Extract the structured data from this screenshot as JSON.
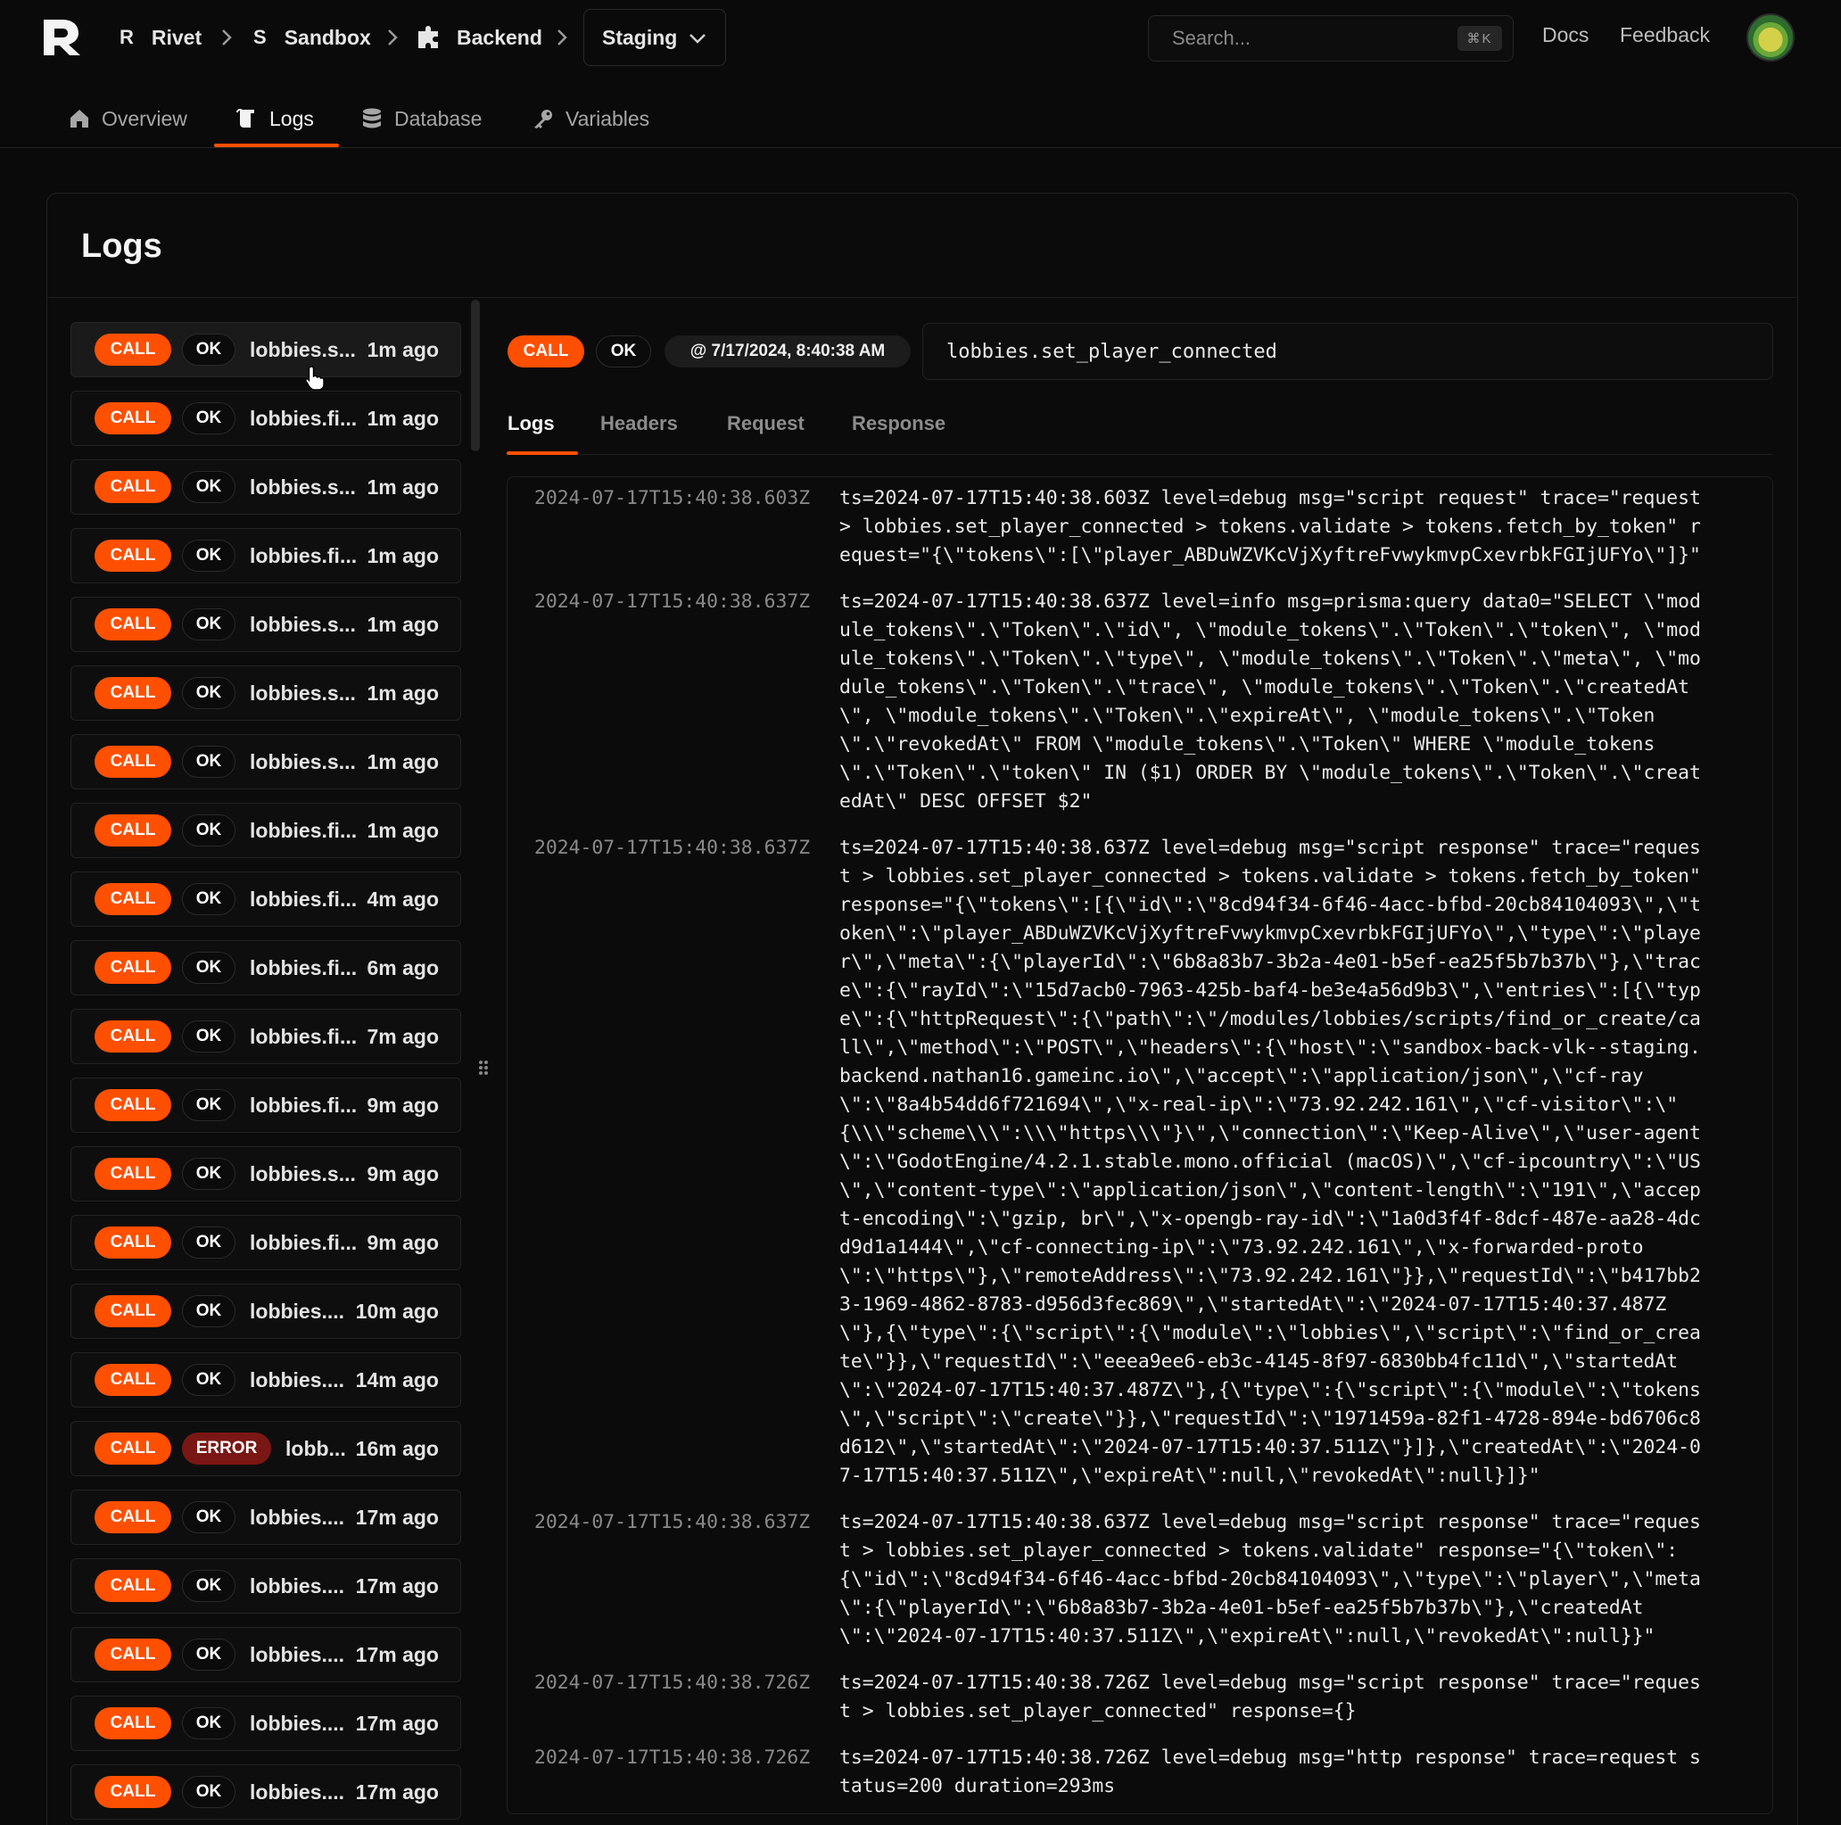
{
  "breadcrumb": {
    "org_initial": "R",
    "org": "Rivet",
    "project_initial": "S",
    "project": "Sandbox",
    "backend": "Backend",
    "environment": "Staging"
  },
  "search": {
    "placeholder": "Search...",
    "shortcut": "⌘K"
  },
  "top_links": {
    "docs": "Docs",
    "feedback": "Feedback"
  },
  "nav_tabs": [
    {
      "label": "Overview",
      "icon": "home-icon"
    },
    {
      "label": "Logs",
      "icon": "logs-icon"
    },
    {
      "label": "Database",
      "icon": "database-icon"
    },
    {
      "label": "Variables",
      "icon": "key-icon"
    }
  ],
  "active_nav_tab": "Logs",
  "page": {
    "title": "Logs"
  },
  "colors": {
    "accent": "#ff4f00",
    "error": "#7a1714",
    "background": "#0a0a0a"
  },
  "log_list": [
    {
      "type": "CALL",
      "status": "OK",
      "name": "lobbies.s...",
      "time": "1m ago"
    },
    {
      "type": "CALL",
      "status": "OK",
      "name": "lobbies.fi...",
      "time": "1m ago"
    },
    {
      "type": "CALL",
      "status": "OK",
      "name": "lobbies.s...",
      "time": "1m ago"
    },
    {
      "type": "CALL",
      "status": "OK",
      "name": "lobbies.fi...",
      "time": "1m ago"
    },
    {
      "type": "CALL",
      "status": "OK",
      "name": "lobbies.s...",
      "time": "1m ago"
    },
    {
      "type": "CALL",
      "status": "OK",
      "name": "lobbies.s...",
      "time": "1m ago"
    },
    {
      "type": "CALL",
      "status": "OK",
      "name": "lobbies.s...",
      "time": "1m ago"
    },
    {
      "type": "CALL",
      "status": "OK",
      "name": "lobbies.fi...",
      "time": "1m ago"
    },
    {
      "type": "CALL",
      "status": "OK",
      "name": "lobbies.fi...",
      "time": "4m ago"
    },
    {
      "type": "CALL",
      "status": "OK",
      "name": "lobbies.fi...",
      "time": "6m ago"
    },
    {
      "type": "CALL",
      "status": "OK",
      "name": "lobbies.fi...",
      "time": "7m ago"
    },
    {
      "type": "CALL",
      "status": "OK",
      "name": "lobbies.fi...",
      "time": "9m ago"
    },
    {
      "type": "CALL",
      "status": "OK",
      "name": "lobbies.s...",
      "time": "9m ago"
    },
    {
      "type": "CALL",
      "status": "OK",
      "name": "lobbies.fi...",
      "time": "9m ago"
    },
    {
      "type": "CALL",
      "status": "OK",
      "name": "lobbies....",
      "time": "10m ago"
    },
    {
      "type": "CALL",
      "status": "OK",
      "name": "lobbies....",
      "time": "14m ago"
    },
    {
      "type": "CALL",
      "status": "ERROR",
      "name": "lobb...",
      "time": "16m ago"
    },
    {
      "type": "CALL",
      "status": "OK",
      "name": "lobbies....",
      "time": "17m ago"
    },
    {
      "type": "CALL",
      "status": "OK",
      "name": "lobbies....",
      "time": "17m ago"
    },
    {
      "type": "CALL",
      "status": "OK",
      "name": "lobbies....",
      "time": "17m ago"
    },
    {
      "type": "CALL",
      "status": "OK",
      "name": "lobbies....",
      "time": "17m ago"
    },
    {
      "type": "CALL",
      "status": "OK",
      "name": "lobbies....",
      "time": "17m ago"
    }
  ],
  "selected_index": 0,
  "detail": {
    "type": "CALL",
    "status": "OK",
    "timestamp": "@ 7/17/2024, 8:40:38 AM",
    "function": "lobbies.set_player_connected",
    "tabs": [
      "Logs",
      "Headers",
      "Request",
      "Response"
    ],
    "active_tab": "Logs",
    "entries": [
      {
        "ts": "2024-07-17T15:40:38.603Z",
        "lines": [
          "ts=2024-07-17T15:40:38.603Z level=debug msg=\"script request\" trace=\"request",
          "> lobbies.set_player_connected > tokens.validate > tokens.fetch_by_token\" r",
          "equest=\"{\\\"tokens\\\":[\\\"player_ABDuWZVKcVjXyftreFvwykmvpCxevrbkFGIjUFYo\\\"]}\""
        ]
      },
      {
        "ts": "2024-07-17T15:40:38.637Z",
        "lines": [
          "ts=2024-07-17T15:40:38.637Z level=info msg=prisma:query data0=\"SELECT \\\"mod",
          "ule_tokens\\\".\\\"Token\\\".\\\"id\\\", \\\"module_tokens\\\".\\\"Token\\\".\\\"token\\\", \\\"mod",
          "ule_tokens\\\".\\\"Token\\\".\\\"type\\\", \\\"module_tokens\\\".\\\"Token\\\".\\\"meta\\\", \\\"mo",
          "dule_tokens\\\".\\\"Token\\\".\\\"trace\\\", \\\"module_tokens\\\".\\\"Token\\\".\\\"createdAt",
          "\\\", \\\"module_tokens\\\".\\\"Token\\\".\\\"expireAt\\\", \\\"module_tokens\\\".\\\"Token",
          "\\\".\\\"revokedAt\\\" FROM \\\"module_tokens\\\".\\\"Token\\\" WHERE \\\"module_tokens",
          "\\\".\\\"Token\\\".\\\"token\\\" IN ($1) ORDER BY \\\"module_tokens\\\".\\\"Token\\\".\\\"creat",
          "edAt\\\" DESC OFFSET $2\""
        ]
      },
      {
        "ts": "2024-07-17T15:40:38.637Z",
        "lines": [
          "ts=2024-07-17T15:40:38.637Z level=debug msg=\"script response\" trace=\"reques",
          "t > lobbies.set_player_connected > tokens.validate > tokens.fetch_by_token\"",
          "response=\"{\\\"tokens\\\":[{\\\"id\\\":\\\"8cd94f34-6f46-4acc-bfbd-20cb84104093\\\",\\\"t",
          "oken\\\":\\\"player_ABDuWZVKcVjXyftreFvwykmvpCxevrbkFGIjUFYo\\\",\\\"type\\\":\\\"playe",
          "r\\\",\\\"meta\\\":{\\\"playerId\\\":\\\"6b8a83b7-3b2a-4e01-b5ef-ea25f5b7b37b\\\"},\\\"trac",
          "e\\\":{\\\"rayId\\\":\\\"15d7acb0-7963-425b-baf4-be3e4a56d9b3\\\",\\\"entries\\\":[{\\\"typ",
          "e\\\":{\\\"httpRequest\\\":{\\\"path\\\":\\\"/modules/lobbies/scripts/find_or_create/ca",
          "ll\\\",\\\"method\\\":\\\"POST\\\",\\\"headers\\\":{\\\"host\\\":\\\"sandbox-back-vlk--staging.",
          "backend.nathan16.gameinc.io\\\",\\\"accept\\\":\\\"application/json\\\",\\\"cf-ray",
          "\\\":\\\"8a4b54dd6f721694\\\",\\\"x-real-ip\\\":\\\"73.92.242.161\\\",\\\"cf-visitor\\\":\\\"",
          "{\\\\\\\"scheme\\\\\\\":\\\\\\\"https\\\\\\\"}\\\",\\\"connection\\\":\\\"Keep-Alive\\\",\\\"user-agent",
          "\\\":\\\"GodotEngine/4.2.1.stable.mono.official (macOS)\\\",\\\"cf-ipcountry\\\":\\\"US",
          "\\\",\\\"content-type\\\":\\\"application/json\\\",\\\"content-length\\\":\\\"191\\\",\\\"accep",
          "t-encoding\\\":\\\"gzip, br\\\",\\\"x-opengb-ray-id\\\":\\\"1a0d3f4f-8dcf-487e-aa28-4dc",
          "d9d1a1444\\\",\\\"cf-connecting-ip\\\":\\\"73.92.242.161\\\",\\\"x-forwarded-proto",
          "\\\":\\\"https\\\"},\\\"remoteAddress\\\":\\\"73.92.242.161\\\"}},\\\"requestId\\\":\\\"b417bb2",
          "3-1969-4862-8783-d956d3fec869\\\",\\\"startedAt\\\":\\\"2024-07-17T15:40:37.487Z",
          "\\\"},{\\\"type\\\":{\\\"script\\\":{\\\"module\\\":\\\"lobbies\\\",\\\"script\\\":\\\"find_or_crea",
          "te\\\"}},\\\"requestId\\\":\\\"eeea9ee6-eb3c-4145-8f97-6830bb4fc11d\\\",\\\"startedAt",
          "\\\":\\\"2024-07-17T15:40:37.487Z\\\"},{\\\"type\\\":{\\\"script\\\":{\\\"module\\\":\\\"tokens",
          "\\\",\\\"script\\\":\\\"create\\\"}},\\\"requestId\\\":\\\"1971459a-82f1-4728-894e-bd6706c8",
          "d612\\\",\\\"startedAt\\\":\\\"2024-07-17T15:40:37.511Z\\\"}]},\\\"createdAt\\\":\\\"2024-0",
          "7-17T15:40:37.511Z\\\",\\\"expireAt\\\":null,\\\"revokedAt\\\":null}]}\""
        ]
      },
      {
        "ts": "2024-07-17T15:40:38.637Z",
        "lines": [
          "ts=2024-07-17T15:40:38.637Z level=debug msg=\"script response\" trace=\"reques",
          "t > lobbies.set_player_connected > tokens.validate\" response=\"{\\\"token\\\":",
          "{\\\"id\\\":\\\"8cd94f34-6f46-4acc-bfbd-20cb84104093\\\",\\\"type\\\":\\\"player\\\",\\\"meta",
          "\\\":{\\\"playerId\\\":\\\"6b8a83b7-3b2a-4e01-b5ef-ea25f5b7b37b\\\"},\\\"createdAt",
          "\\\":\\\"2024-07-17T15:40:37.511Z\\\",\\\"expireAt\\\":null,\\\"revokedAt\\\":null}}\""
        ]
      },
      {
        "ts": "2024-07-17T15:40:38.726Z",
        "lines": [
          "ts=2024-07-17T15:40:38.726Z level=debug msg=\"script response\" trace=\"reques",
          "t > lobbies.set_player_connected\" response={}"
        ]
      },
      {
        "ts": "2024-07-17T15:40:38.726Z",
        "lines": [
          "ts=2024-07-17T15:40:38.726Z level=debug msg=\"http response\" trace=request s",
          "tatus=200 duration=293ms"
        ]
      }
    ]
  }
}
